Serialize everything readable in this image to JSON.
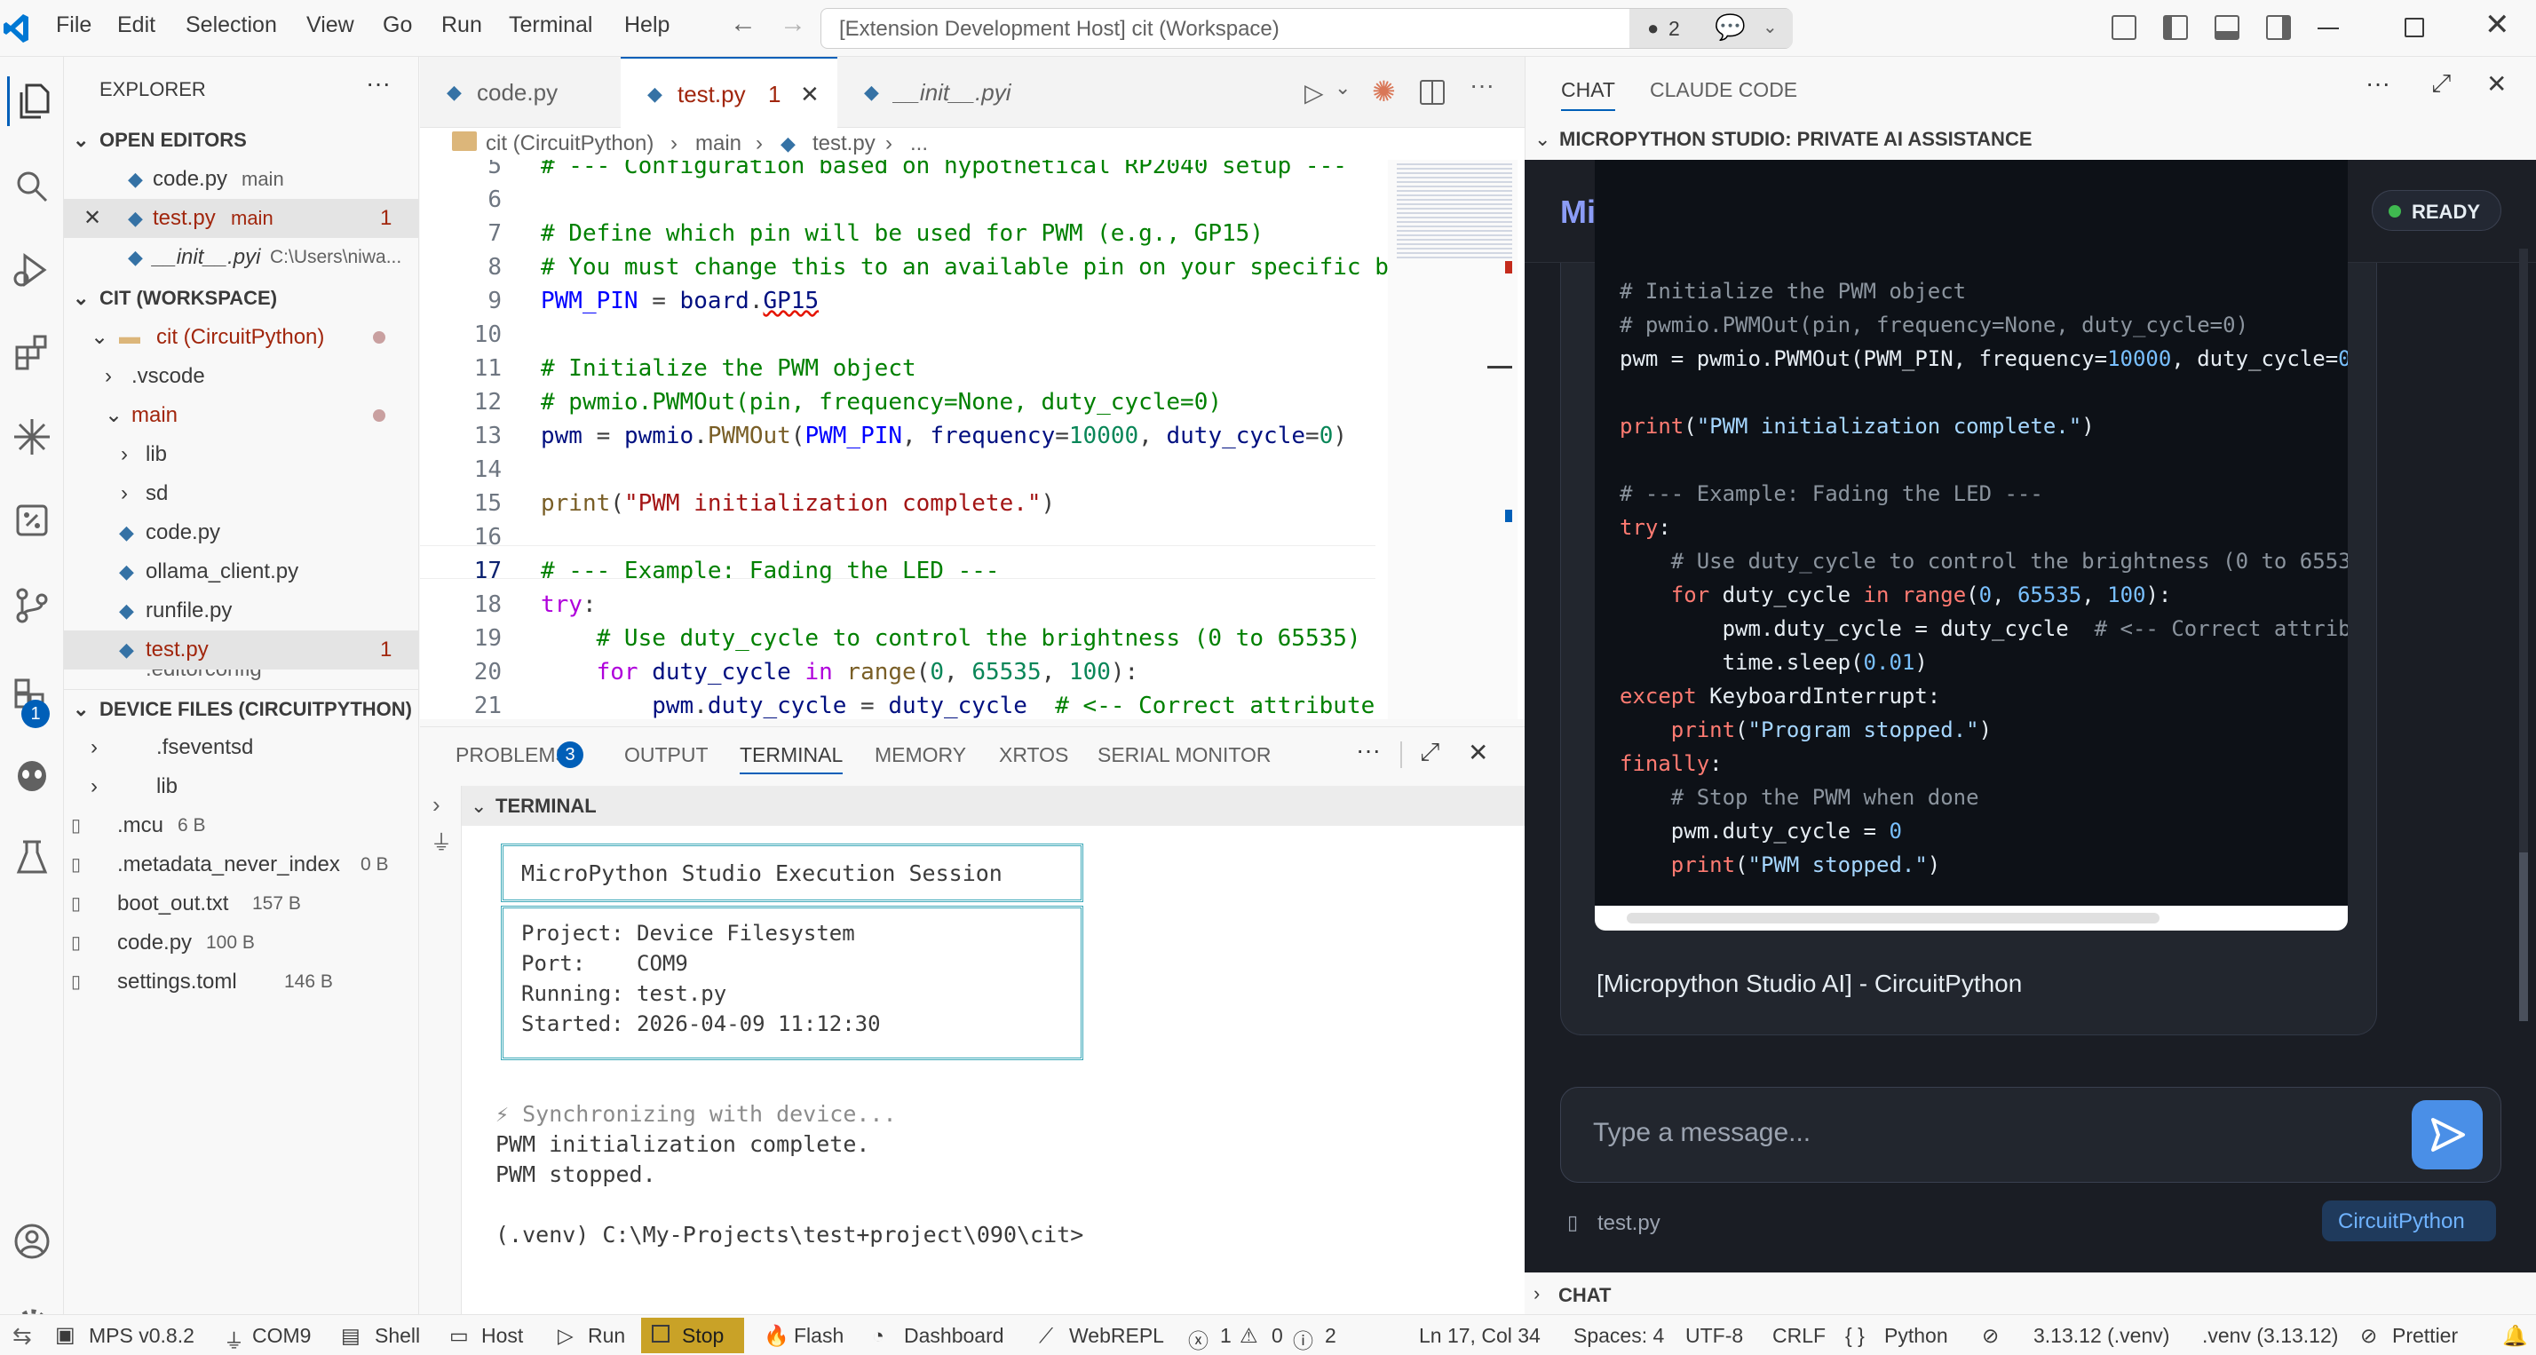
{
  "menu": [
    "File",
    "Edit",
    "Selection",
    "View",
    "Go",
    "Run",
    "Terminal",
    "Help"
  ],
  "command_center": {
    "text": "[Extension Development Host] cit (Workspace)",
    "badge": "2"
  },
  "activity": {
    "badge": "1"
  },
  "explorer": {
    "title": "EXPLORER",
    "open_editors_header": "OPEN EDITORS",
    "open_editors": [
      {
        "name": "code.py",
        "desc": "main"
      },
      {
        "name": "test.py",
        "desc": "main",
        "count": "1"
      },
      {
        "name": "__init__.pyi",
        "desc": "C:\\Users\\niwa..."
      }
    ],
    "workspace_header": "CIT (WORKSPACE)",
    "tree": [
      {
        "name": "cit (CircuitPython)"
      },
      {
        "name": ".vscode"
      },
      {
        "name": "main"
      },
      {
        "name": "lib"
      },
      {
        "name": "sd"
      },
      {
        "name": "code.py"
      },
      {
        "name": "ollama_client.py"
      },
      {
        "name": "runfile.py"
      },
      {
        "name": "test.py",
        "count": "1"
      },
      {
        "name": ".editorconfig"
      }
    ],
    "device_header": "DEVICE FILES (CIRCUITPYTHON)",
    "device": [
      {
        "name": ".fseventsd",
        "size": ""
      },
      {
        "name": "lib",
        "size": ""
      },
      {
        "name": ".mcu",
        "size": "6 B"
      },
      {
        "name": ".metadata_never_index",
        "size": "0 B"
      },
      {
        "name": "boot_out.txt",
        "size": "157 B"
      },
      {
        "name": "code.py",
        "size": "100 B"
      },
      {
        "name": "settings.toml",
        "size": "146 B"
      }
    ]
  },
  "editor": {
    "tabs": [
      {
        "label": "code.py"
      },
      {
        "label": "test.py",
        "count": "1"
      },
      {
        "label": "__init__.pyi"
      }
    ],
    "breadcrumb": [
      "cit (CircuitPython)",
      "main",
      "test.py",
      "..."
    ],
    "line_numbers": [
      "5",
      "6",
      "7",
      "8",
      "9",
      "10",
      "11",
      "12",
      "13",
      "14",
      "15",
      "16",
      "17",
      "18",
      "19",
      "20",
      "21"
    ]
  },
  "panel": {
    "tabs": [
      "PROBLEMS",
      "OUTPUT",
      "TERMINAL",
      "MEMORY",
      "XRTOS",
      "SERIAL MONITOR"
    ],
    "problems_count": "3",
    "terminal_label": "TERMINAL",
    "session_title": "MicroPython Studio Execution Session",
    "session_lines": [
      "Project: Device Filesystem",
      "Port:    COM9",
      "Running: test.py",
      "Started: 2026-04-09 11:12:30"
    ],
    "output": [
      "⚡ Synchronizing with device...",
      "PWM initialization complete.",
      "PWM stopped.",
      "",
      "(.venv) C:\\My-Projects\\test+project\\090\\cit>"
    ]
  },
  "chat": {
    "tabs": [
      "CHAT",
      "CLAUDE CODE"
    ],
    "section": "MICROPYTHON STUDIO: PRIVATE AI ASSISTANCE",
    "brand": "Micro AI",
    "status": "READY",
    "signature": "[Micropython Studio AI] - CircuitPython",
    "input_placeholder": "Type a message...",
    "attachment": "test.py",
    "language_chip": "CircuitPython",
    "footer": "CHAT"
  },
  "status": {
    "mps": "MPS v0.8.2",
    "port": "COM9",
    "shell": "Shell",
    "host": "Host",
    "run": "Run",
    "stop": "Stop",
    "flash": "Flash",
    "dashboard": "Dashboard",
    "webrepl": "WebREPL",
    "errors": "1",
    "warnings": "0",
    "infos": "2",
    "position": "Ln 17, Col 34",
    "spaces": "Spaces: 4",
    "encoding": "UTF-8",
    "eol": "CRLF",
    "language": "Python",
    "interpreter": "3.13.12 (.venv)",
    "venv": ".venv (3.13.12)",
    "prettier": "Prettier"
  }
}
